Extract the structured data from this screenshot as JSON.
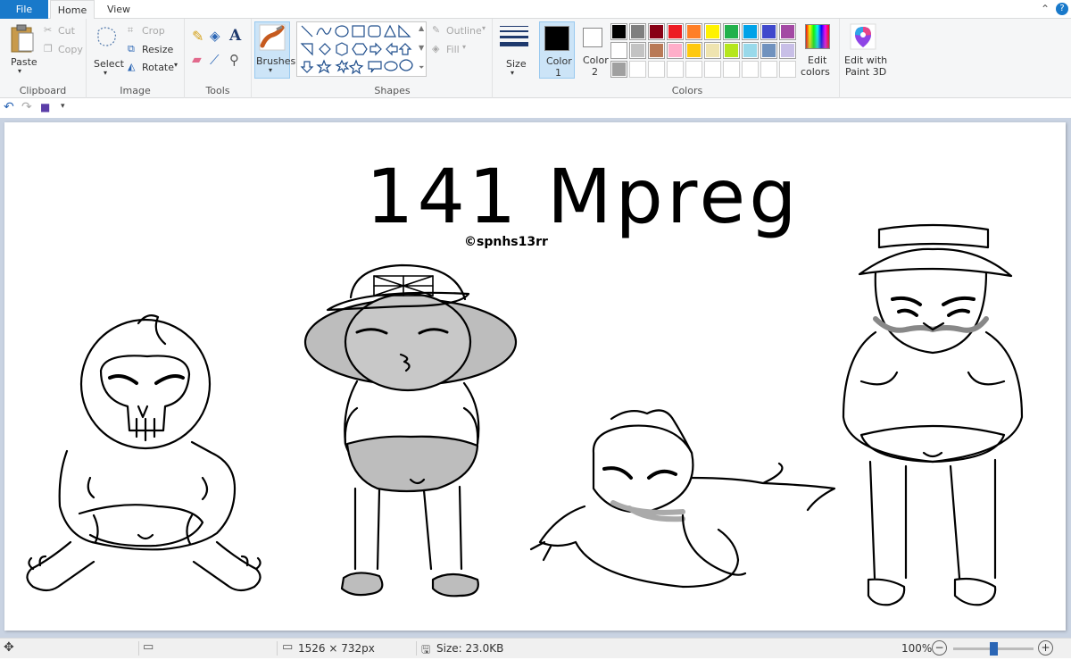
{
  "tabs": {
    "file": "File",
    "home": "Home",
    "view": "View"
  },
  "clipboard": {
    "paste": "Paste",
    "cut": "Cut",
    "copy": "Copy",
    "label": "Clipboard"
  },
  "image": {
    "select": "Select",
    "crop": "Crop",
    "resize": "Resize",
    "rotate": "Rotate",
    "label": "Image"
  },
  "tools": {
    "label": "Tools"
  },
  "brushes": {
    "label": "Brushes"
  },
  "shapes": {
    "outline": "Outline",
    "fill": "Fill",
    "label": "Shapes"
  },
  "size": {
    "label": "Size"
  },
  "colors": {
    "color1": "Color",
    "color1_num": "1",
    "color2": "Color",
    "color2_num": "2",
    "edit_line1": "Edit",
    "edit_line2": "colors",
    "paint3d_line1": "Edit with",
    "paint3d_line2": "Paint 3D",
    "label": "Colors",
    "color1_value": "#000000",
    "color2_value": "#ffffff",
    "palette_row1": [
      "#000000",
      "#7f7f7f",
      "#880015",
      "#ed1c24",
      "#ff7f27",
      "#fff200",
      "#22b14c",
      "#00a2e8",
      "#3f48cc",
      "#a349a4"
    ],
    "palette_row2": [
      "#ffffff",
      "#c3c3c3",
      "#b97a57",
      "#ffaec9",
      "#ffc90e",
      "#efe4b0",
      "#b5e61d",
      "#99d9ea",
      "#7092be",
      "#c8bfe7"
    ],
    "palette_row3": [
      "#a0a0a0",
      "",
      "",
      "",
      "",
      "",
      "",
      "",
      "",
      ""
    ]
  },
  "canvas": {
    "title_text": "141 Mpreg",
    "signature_text": "©spnhs13rr"
  },
  "status": {
    "dimensions": "1526 × 732px",
    "size": "Size: 23.0KB",
    "zoom": "100%",
    "zoom_level": 0.5
  }
}
